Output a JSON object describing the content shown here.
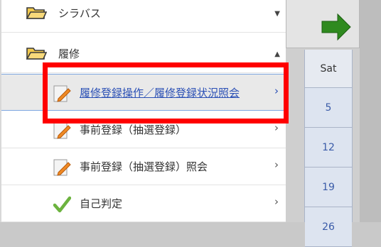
{
  "menu": {
    "syllabus": {
      "label": "シラバス",
      "caret": "▼"
    },
    "courses": {
      "label": "履修",
      "caret": "▲"
    },
    "items": [
      {
        "label": "履修登録操作／履修登録状況照会",
        "chevron": "›"
      },
      {
        "label": "事前登録（抽選登録）",
        "chevron": "›"
      },
      {
        "label": "事前登録（抽選登録）照会",
        "chevron": "›"
      },
      {
        "label": "自己判定",
        "chevron": "›"
      }
    ]
  },
  "calendar": {
    "header": "Sat",
    "cells": [
      "5",
      "12",
      "19",
      "26"
    ]
  },
  "colors": {
    "highlight": "#ff0000",
    "arrow": "#2f8a1f",
    "link": "#2a4fb5"
  }
}
